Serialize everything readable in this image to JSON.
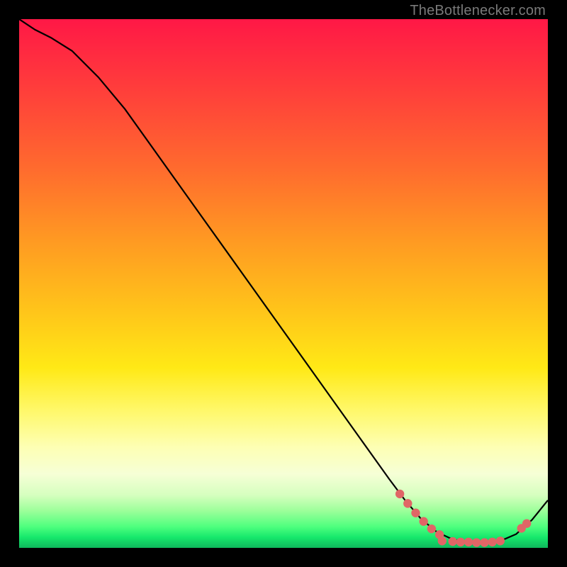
{
  "watermark": "TheBottlenecker.com",
  "colors": {
    "curve": "#000000",
    "dots": "#e06666"
  },
  "chart_data": {
    "type": "line",
    "title": "",
    "xlabel": "",
    "ylabel": "",
    "xlim": [
      0,
      100
    ],
    "ylim": [
      0,
      100
    ],
    "grid": false,
    "legend": false,
    "series": [
      {
        "name": "curve",
        "x": [
          0,
          3,
          6,
          10,
          15,
          20,
          25,
          30,
          35,
          40,
          45,
          50,
          55,
          60,
          65,
          70,
          73,
          76,
          79,
          82,
          85,
          88,
          91,
          94,
          97,
          100
        ],
        "y": [
          100,
          98,
          96.5,
          94,
          89,
          83,
          76,
          69,
          62,
          55,
          48,
          41,
          34,
          27,
          20,
          13,
          9,
          5.5,
          3,
          1.6,
          1.1,
          1.0,
          1.3,
          2.6,
          5.3,
          9
        ]
      }
    ],
    "points": [
      {
        "name": "dot-cluster",
        "x": 72,
        "y": 10.2
      },
      {
        "name": "dot-cluster",
        "x": 73.5,
        "y": 8.4
      },
      {
        "name": "dot-cluster",
        "x": 75,
        "y": 6.6
      },
      {
        "name": "dot-cluster",
        "x": 76.5,
        "y": 5.0
      },
      {
        "name": "dot-cluster",
        "x": 78,
        "y": 3.6
      },
      {
        "name": "dot-cluster",
        "x": 79.5,
        "y": 2.5
      },
      {
        "name": "dot-cluster",
        "x": 80,
        "y": 1.3
      },
      {
        "name": "dot-cluster",
        "x": 82,
        "y": 1.2
      },
      {
        "name": "dot-cluster",
        "x": 83.5,
        "y": 1.1
      },
      {
        "name": "dot-cluster",
        "x": 85,
        "y": 1.1
      },
      {
        "name": "dot-cluster",
        "x": 86.5,
        "y": 1.0
      },
      {
        "name": "dot-cluster",
        "x": 88,
        "y": 1.0
      },
      {
        "name": "dot-cluster",
        "x": 89.5,
        "y": 1.1
      },
      {
        "name": "dot-cluster",
        "x": 91,
        "y": 1.3
      },
      {
        "name": "dot-cluster",
        "x": 95,
        "y": 3.7
      },
      {
        "name": "dot-cluster",
        "x": 96,
        "y": 4.6
      }
    ]
  }
}
